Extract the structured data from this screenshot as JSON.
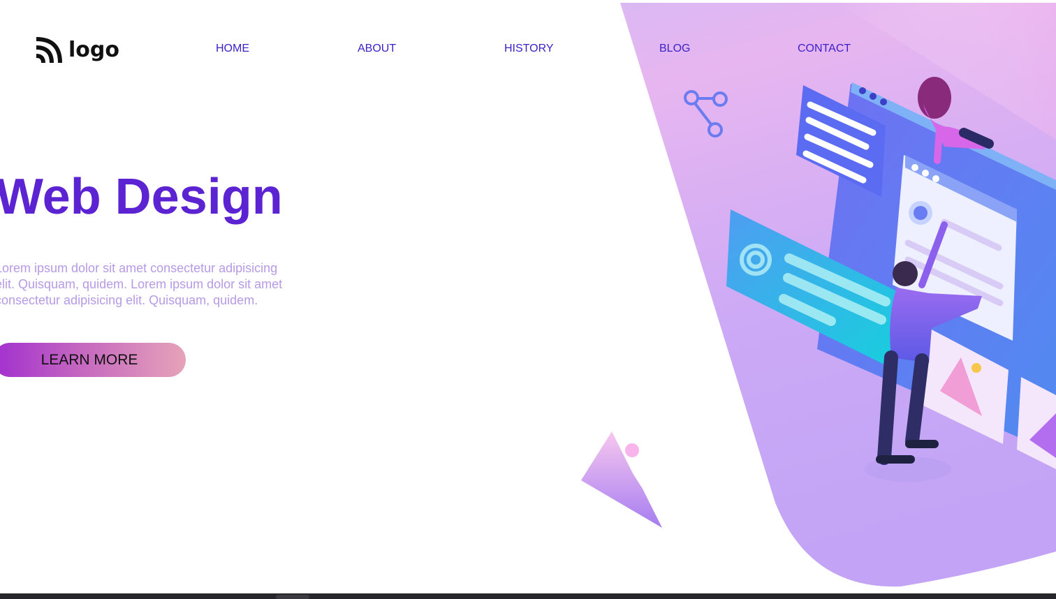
{
  "brand": {
    "logo_text": "logo"
  },
  "nav": {
    "items": [
      {
        "label": "HOME"
      },
      {
        "label": "ABOUT"
      },
      {
        "label": "HISTORY"
      },
      {
        "label": "BLOG"
      },
      {
        "label": "CONTACT"
      }
    ]
  },
  "hero": {
    "title": "Web Design",
    "description": "Lorem ipsum dolor sit amet consectetur adipisicing elit. Quisquam, quidem. Lorem ipsum dolor sit amet consectetur adipisicing elit. Quisquam, quidem.",
    "cta_label": "LEARN MORE"
  },
  "colors": {
    "accent": "#5b23d1",
    "nav": "#3a22c6",
    "blob_top": "#f3b8ee",
    "blob_bottom": "#c3a6f6"
  },
  "illustration": {
    "icons": [
      "share-icon",
      "image-icon",
      "gear-icon",
      "mountain-icon"
    ]
  }
}
